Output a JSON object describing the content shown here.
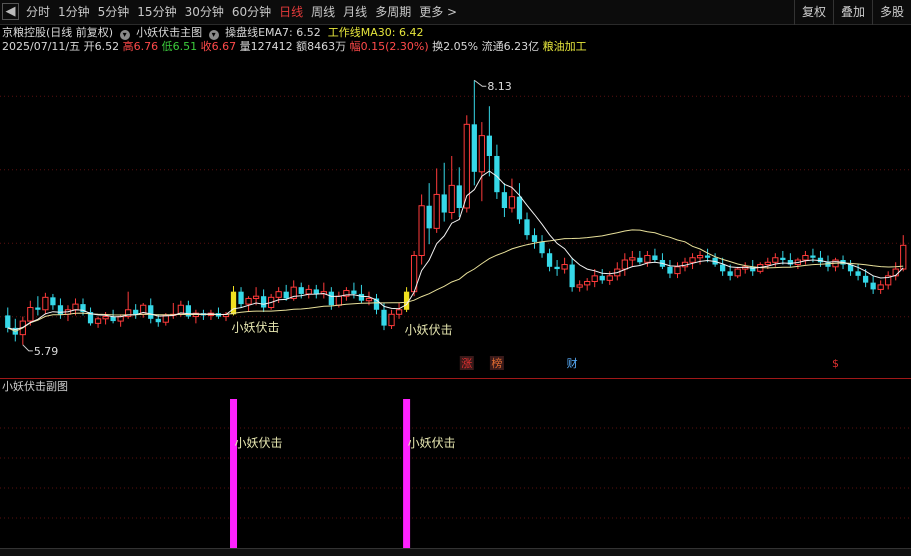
{
  "toolbar": {
    "back_glyph": "◀",
    "periods": [
      "分时",
      "1分钟",
      "5分钟",
      "15分钟",
      "30分钟",
      "60分钟",
      "日线",
      "周线",
      "月线",
      "多周期",
      "更多 >"
    ],
    "active_period": "日线",
    "right_tools": [
      "复权",
      "叠加",
      "多股"
    ]
  },
  "header": {
    "stock_name": "京粮控股(日线 前复权)",
    "indicator_name": "小妖伏击主图",
    "ema_label": "操盘线EMA7: 6.52",
    "ma_label": "工作线MA30: 6.42",
    "date": "2025/07/11/五",
    "open_label": "开",
    "open": "6.52",
    "high_label": "高",
    "high": "6.76",
    "low_label": "低",
    "low": "6.51",
    "close_label": "收",
    "close": "6.67",
    "vol_label": "量127412",
    "amount_label": "额8463万",
    "change_label": "幅",
    "change": "0.15(2.30%)",
    "turnover_label": "换2.05%",
    "float_label": "流通6.23亿",
    "industry": "粮油加工"
  },
  "sub_panel": {
    "title": "小妖伏击副图"
  },
  "colors": {
    "up": "#ff3b3b",
    "down": "#36d8e8",
    "ema": "#f2f2f2",
    "ma": "#e8e09a",
    "signal": "#f0e020",
    "sub_bar": "#ff22ff"
  },
  "chart_data": {
    "type": "candlestick",
    "price_range": [
      5.7,
      8.3
    ],
    "high_marker": "8.13",
    "low_marker": "5.79",
    "signal_text": "小妖伏击",
    "signal_indices": [
      30,
      53
    ],
    "event_markers": [
      {
        "index": 61,
        "text": "涨",
        "color": "#e03030",
        "bg": true
      },
      {
        "index": 65,
        "text": "榜",
        "color": "#e06a30",
        "bg": true
      },
      {
        "index": 75,
        "text": "财",
        "color": "#5ab0ff",
        "bg": false
      },
      {
        "index": 110,
        "text": "$",
        "color": "#e03030",
        "bg": false
      }
    ],
    "ohlc": [
      [
        6.05,
        6.12,
        5.9,
        5.94
      ],
      [
        5.94,
        6.02,
        5.82,
        5.88
      ],
      [
        5.88,
        6.04,
        5.79,
        6.0
      ],
      [
        6.0,
        6.18,
        5.96,
        6.12
      ],
      [
        6.12,
        6.22,
        6.05,
        6.1
      ],
      [
        6.1,
        6.25,
        6.06,
        6.21
      ],
      [
        6.21,
        6.24,
        6.1,
        6.14
      ],
      [
        6.14,
        6.2,
        6.02,
        6.06
      ],
      [
        6.06,
        6.14,
        6.0,
        6.1
      ],
      [
        6.1,
        6.2,
        6.05,
        6.15
      ],
      [
        6.15,
        6.2,
        6.05,
        6.08
      ],
      [
        6.08,
        6.12,
        5.96,
        5.98
      ],
      [
        5.98,
        6.04,
        5.94,
        6.02
      ],
      [
        6.02,
        6.08,
        5.97,
        6.04
      ],
      [
        6.04,
        6.1,
        5.98,
        6.0
      ],
      [
        6.0,
        6.06,
        5.95,
        6.04
      ],
      [
        6.04,
        6.26,
        6.02,
        6.1
      ],
      [
        6.1,
        6.15,
        6.02,
        6.06
      ],
      [
        6.06,
        6.16,
        6.03,
        6.14
      ],
      [
        6.14,
        6.2,
        5.98,
        6.02
      ],
      [
        6.02,
        6.06,
        5.95,
        5.99
      ],
      [
        5.99,
        6.07,
        5.96,
        6.05
      ],
      [
        6.05,
        6.16,
        6.02,
        6.06
      ],
      [
        6.06,
        6.18,
        6.04,
        6.14
      ],
      [
        6.14,
        6.18,
        6.02,
        6.04
      ],
      [
        6.04,
        6.1,
        5.98,
        6.07
      ],
      [
        6.07,
        6.1,
        6.01,
        6.05
      ],
      [
        6.05,
        6.1,
        6.01,
        6.07
      ],
      [
        6.07,
        6.12,
        6.02,
        6.04
      ],
      [
        6.04,
        6.08,
        6.0,
        6.06
      ],
      [
        6.06,
        6.31,
        6.05,
        6.26
      ],
      [
        6.26,
        6.3,
        6.12,
        6.15
      ],
      [
        6.15,
        6.22,
        6.08,
        6.2
      ],
      [
        6.2,
        6.3,
        6.14,
        6.22
      ],
      [
        6.22,
        6.28,
        6.08,
        6.12
      ],
      [
        6.12,
        6.24,
        6.1,
        6.21
      ],
      [
        6.21,
        6.3,
        6.16,
        6.26
      ],
      [
        6.26,
        6.32,
        6.18,
        6.2
      ],
      [
        6.2,
        6.36,
        6.18,
        6.3
      ],
      [
        6.3,
        6.34,
        6.2,
        6.24
      ],
      [
        6.24,
        6.32,
        6.2,
        6.28
      ],
      [
        6.28,
        6.32,
        6.2,
        6.24
      ],
      [
        6.24,
        6.34,
        6.2,
        6.26
      ],
      [
        6.26,
        6.3,
        6.1,
        6.14
      ],
      [
        6.14,
        6.26,
        6.12,
        6.22
      ],
      [
        6.22,
        6.3,
        6.18,
        6.27
      ],
      [
        6.27,
        6.34,
        6.2,
        6.24
      ],
      [
        6.24,
        6.32,
        6.16,
        6.18
      ],
      [
        6.18,
        6.26,
        6.14,
        6.2
      ],
      [
        6.2,
        6.24,
        6.06,
        6.1
      ],
      [
        6.1,
        6.16,
        5.92,
        5.96
      ],
      [
        5.96,
        6.1,
        5.93,
        6.06
      ],
      [
        6.06,
        6.16,
        6.02,
        6.1
      ],
      [
        6.1,
        6.3,
        6.08,
        6.26
      ],
      [
        6.26,
        6.62,
        6.22,
        6.58
      ],
      [
        6.58,
        7.12,
        6.5,
        7.02
      ],
      [
        7.02,
        7.22,
        6.68,
        6.82
      ],
      [
        6.82,
        7.35,
        6.78,
        7.12
      ],
      [
        7.12,
        7.4,
        6.88,
        6.96
      ],
      [
        6.96,
        7.46,
        6.9,
        7.2
      ],
      [
        7.2,
        7.36,
        6.92,
        7.0
      ],
      [
        7.0,
        7.82,
        6.96,
        7.74
      ],
      [
        7.74,
        8.13,
        7.2,
        7.32
      ],
      [
        7.32,
        7.76,
        7.06,
        7.64
      ],
      [
        7.64,
        7.9,
        7.28,
        7.46
      ],
      [
        7.46,
        7.56,
        7.08,
        7.14
      ],
      [
        7.14,
        7.22,
        6.92,
        7.0
      ],
      [
        7.0,
        7.26,
        6.96,
        7.1
      ],
      [
        7.1,
        7.22,
        6.86,
        6.9
      ],
      [
        6.9,
        6.96,
        6.72,
        6.76
      ],
      [
        6.76,
        6.82,
        6.64,
        6.7
      ],
      [
        6.7,
        6.76,
        6.56,
        6.6
      ],
      [
        6.6,
        6.64,
        6.44,
        6.48
      ],
      [
        6.48,
        6.54,
        6.4,
        6.46
      ],
      [
        6.46,
        6.56,
        6.42,
        6.5
      ],
      [
        6.5,
        6.56,
        6.26,
        6.3
      ],
      [
        6.3,
        6.36,
        6.26,
        6.32
      ],
      [
        6.32,
        6.38,
        6.27,
        6.35
      ],
      [
        6.35,
        6.46,
        6.3,
        6.4
      ],
      [
        6.4,
        6.46,
        6.33,
        6.36
      ],
      [
        6.36,
        6.44,
        6.32,
        6.4
      ],
      [
        6.4,
        6.52,
        6.36,
        6.46
      ],
      [
        6.46,
        6.6,
        6.4,
        6.54
      ],
      [
        6.54,
        6.62,
        6.48,
        6.56
      ],
      [
        6.56,
        6.62,
        6.5,
        6.52
      ],
      [
        6.52,
        6.62,
        6.48,
        6.58
      ],
      [
        6.58,
        6.64,
        6.52,
        6.54
      ],
      [
        6.54,
        6.6,
        6.46,
        6.48
      ],
      [
        6.48,
        6.54,
        6.38,
        6.42
      ],
      [
        6.42,
        6.52,
        6.38,
        6.48
      ],
      [
        6.48,
        6.56,
        6.44,
        6.52
      ],
      [
        6.52,
        6.6,
        6.46,
        6.56
      ],
      [
        6.56,
        6.62,
        6.5,
        6.58
      ],
      [
        6.58,
        6.64,
        6.52,
        6.56
      ],
      [
        6.56,
        6.6,
        6.48,
        6.5
      ],
      [
        6.5,
        6.56,
        6.4,
        6.44
      ],
      [
        6.44,
        6.5,
        6.36,
        6.4
      ],
      [
        6.4,
        6.48,
        6.38,
        6.46
      ],
      [
        6.46,
        6.52,
        6.42,
        6.48
      ],
      [
        6.48,
        6.54,
        6.4,
        6.44
      ],
      [
        6.44,
        6.52,
        6.42,
        6.5
      ],
      [
        6.5,
        6.56,
        6.46,
        6.52
      ],
      [
        6.52,
        6.6,
        6.48,
        6.56
      ],
      [
        6.56,
        6.62,
        6.5,
        6.54
      ],
      [
        6.54,
        6.6,
        6.48,
        6.5
      ],
      [
        6.5,
        6.56,
        6.46,
        6.54
      ],
      [
        6.54,
        6.62,
        6.5,
        6.58
      ],
      [
        6.58,
        6.64,
        6.52,
        6.56
      ],
      [
        6.56,
        6.62,
        6.48,
        6.52
      ],
      [
        6.52,
        6.58,
        6.44,
        6.48
      ],
      [
        6.48,
        6.56,
        6.44,
        6.54
      ],
      [
        6.54,
        6.58,
        6.46,
        6.5
      ],
      [
        6.5,
        6.54,
        6.4,
        6.44
      ],
      [
        6.44,
        6.5,
        6.36,
        6.4
      ],
      [
        6.4,
        6.46,
        6.3,
        6.34
      ],
      [
        6.34,
        6.4,
        6.24,
        6.28
      ],
      [
        6.28,
        6.36,
        6.24,
        6.32
      ],
      [
        6.32,
        6.44,
        6.28,
        6.4
      ],
      [
        6.4,
        6.52,
        6.36,
        6.46
      ],
      [
        6.46,
        6.76,
        6.44,
        6.67
      ]
    ]
  }
}
